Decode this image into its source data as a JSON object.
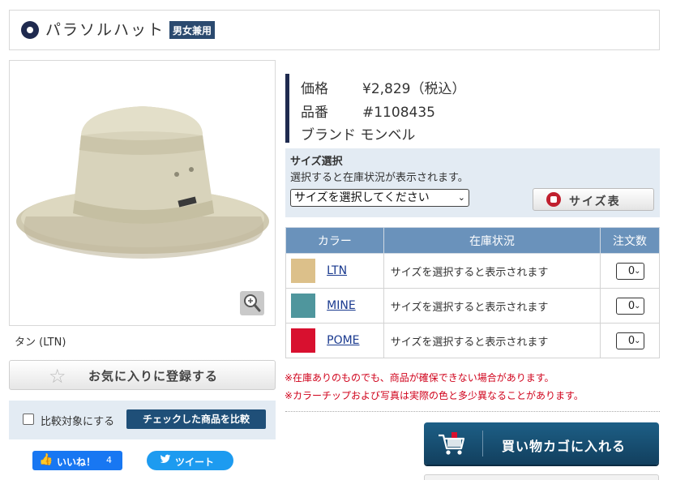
{
  "product": {
    "title": "パラソルハット",
    "badge": "男女兼用"
  },
  "image": {
    "caption": "タン (LTN)",
    "zoom_icon": "zoom-in-icon"
  },
  "favorites": {
    "label": "お気に入りに登録する",
    "icon": "star-outline-icon"
  },
  "compare": {
    "checkbox_label": "比較対象にする",
    "button_label": "チェックした商品を比較"
  },
  "social": {
    "like_label": "いいね！",
    "like_count": "4",
    "tweet_label": "ツイート"
  },
  "info": {
    "price_label": "価格",
    "price_value": "¥2,829（税込）",
    "sku_label": "品番",
    "sku_value": "#1108435",
    "brand_label": "ブランド",
    "brand_value": "モンベル"
  },
  "size": {
    "title": "サイズ選択",
    "description": "選択すると在庫状況が表示されます。",
    "select_value": "サイズを選択してください",
    "chart_label": "サイズ表"
  },
  "stock_table": {
    "headers": [
      "カラー",
      "在庫状況",
      "注文数"
    ],
    "rows": [
      {
        "color_code": "LTN",
        "swatch": "#dcc08a",
        "status": "サイズを選択すると表示されます",
        "qty": "0"
      },
      {
        "color_code": "MINE",
        "swatch": "#4f969d",
        "status": "サイズを選択すると表示されます",
        "qty": "0"
      },
      {
        "color_code": "POME",
        "swatch": "#d8102f",
        "status": "サイズを選択すると表示されます",
        "qty": "0"
      }
    ]
  },
  "notes": [
    "※在庫ありのものでも、商品が確保できない場合があります。",
    "※カラーチップおよび写真は実際の色と多少異なることがあります。"
  ],
  "cart": {
    "label": "買い物カゴに入れる",
    "icon": "shopping-cart-icon"
  }
}
